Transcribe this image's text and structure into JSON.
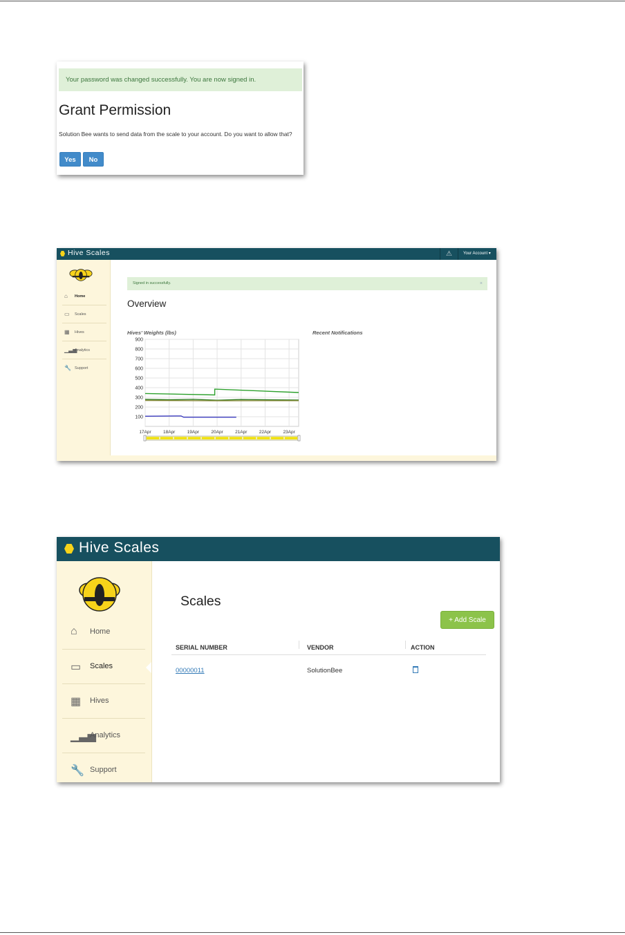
{
  "permission": {
    "alert": "Your password was changed successfully. You are now signed in.",
    "title": "Grant Permission",
    "description": "Solution Bee wants to send data from the scale to your account. Do you want to allow that?",
    "yes_label": "Yes",
    "no_label": "No"
  },
  "overview": {
    "brand": "Hive Scales",
    "account": "Your Account ▾",
    "sidebar": [
      {
        "label": "Home",
        "icon": "home-icon"
      },
      {
        "label": "Scales",
        "icon": "scale-icon"
      },
      {
        "label": "Hives",
        "icon": "grid-icon"
      },
      {
        "label": "Analytics",
        "icon": "bars-icon"
      },
      {
        "label": "Support",
        "icon": "wrench-icon"
      }
    ],
    "alert": "Signed in successfully.",
    "alert_close": "×",
    "title": "Overview",
    "chart_title": "Hives' Weights (lbs)",
    "notifications_title": "Recent Notifications"
  },
  "chart_data": {
    "type": "line",
    "title": "Hives' Weights (lbs)",
    "x_tick_labels": [
      "17Apr",
      "18Apr",
      "19Apr",
      "20Apr",
      "21Apr",
      "22Apr",
      "23Apr"
    ],
    "y_ticks": [
      100,
      200,
      300,
      400,
      500,
      600,
      700,
      800,
      900
    ],
    "ylim": [
      0,
      900
    ],
    "xlim": [
      "17Apr",
      "23.4Apr"
    ],
    "grid": true,
    "series": [
      {
        "color": "#2ca02c",
        "points": [
          [
            17.0,
            340
          ],
          [
            19.9,
            325
          ],
          [
            19.9,
            385
          ],
          [
            23.4,
            350
          ]
        ]
      },
      {
        "color": "#2d7a1e",
        "points": [
          [
            17.0,
            280
          ],
          [
            18.0,
            275
          ],
          [
            19.0,
            280
          ],
          [
            20.0,
            270
          ],
          [
            21.0,
            278
          ],
          [
            22.0,
            275
          ],
          [
            23.4,
            272
          ]
        ]
      },
      {
        "color": "#8a8a3a",
        "points": [
          [
            17.0,
            268
          ],
          [
            20.0,
            265
          ],
          [
            23.4,
            266
          ]
        ]
      },
      {
        "color": "#3b3bbf",
        "points": [
          [
            17.0,
            105
          ],
          [
            18.5,
            108
          ],
          [
            18.6,
            95
          ],
          [
            20.8,
            95
          ]
        ]
      }
    ]
  },
  "scales": {
    "brand": "Hive Scales",
    "sidebar": [
      {
        "label": "Home",
        "icon": "home-icon"
      },
      {
        "label": "Scales",
        "icon": "scale-icon"
      },
      {
        "label": "Hives",
        "icon": "grid-icon"
      },
      {
        "label": "Analytics",
        "icon": "bars-icon"
      },
      {
        "label": "Support",
        "icon": "wrench-icon"
      }
    ],
    "title": "Scales",
    "add_label": "+ Add Scale",
    "columns": [
      "SERIAL NUMBER",
      "VENDOR",
      "ACTION"
    ],
    "rows": [
      {
        "serial": "00000011",
        "vendor": "SolutionBee"
      }
    ]
  }
}
